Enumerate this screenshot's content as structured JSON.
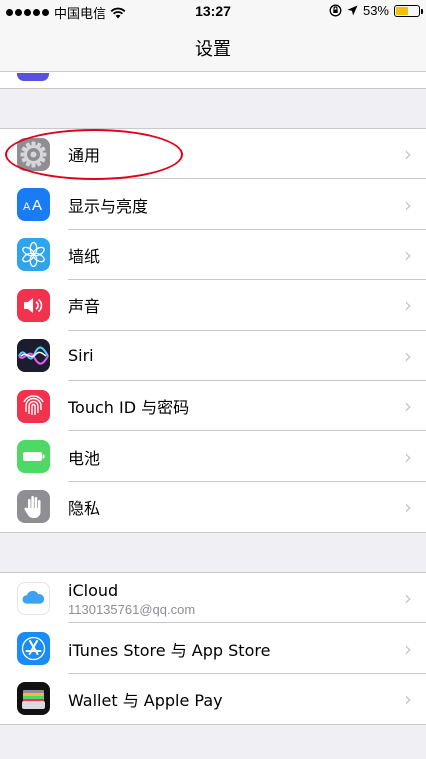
{
  "status_bar": {
    "carrier": "中国电信",
    "time": "13:27",
    "battery_percent": "53%",
    "battery_level": 0.53,
    "wifi_icon": "wifi-icon",
    "lock_icon": "rotation-lock-icon",
    "location_icon": "location-arrow-icon"
  },
  "nav": {
    "title": "设置"
  },
  "groups": [
    {
      "items": [
        {
          "label": "通用",
          "icon": "gear-icon",
          "color": "#8e8e93"
        },
        {
          "label": "显示与亮度",
          "icon": "text-size-icon",
          "color": "#1a7cf5"
        },
        {
          "label": "墙纸",
          "icon": "flower-icon",
          "color": "#2ea4ec"
        },
        {
          "label": "声音",
          "icon": "speaker-icon",
          "color": "#f2334e"
        },
        {
          "label": "Siri",
          "icon": "siri-icon",
          "color": "#222222"
        },
        {
          "label": "Touch ID 与密码",
          "icon": "fingerprint-icon",
          "color": "#f2334e"
        },
        {
          "label": "电池",
          "icon": "battery-icon",
          "color": "#4cd964"
        },
        {
          "label": "隐私",
          "icon": "hand-icon",
          "color": "#8e8e93"
        }
      ]
    },
    {
      "items": [
        {
          "label": "iCloud",
          "sublabel": "1130135761@qq.com",
          "icon": "cloud-icon",
          "color": "#ffffff"
        },
        {
          "label": "iTunes Store 与 App Store",
          "icon": "app-store-icon",
          "color": "#1a8cf5"
        },
        {
          "label": "Wallet 与 Apple Pay",
          "icon": "wallet-icon",
          "color": "#111111"
        }
      ]
    }
  ],
  "chevron": "›"
}
